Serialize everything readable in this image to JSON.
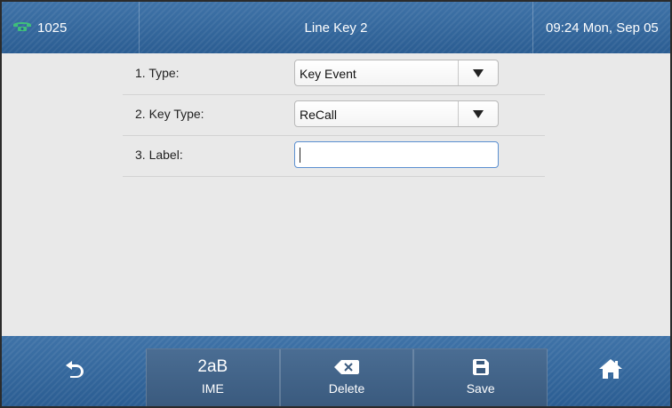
{
  "status_bar": {
    "account": "1025",
    "title": "Line Key 2",
    "clock": "09:24 Mon, Sep 05"
  },
  "form": {
    "rows": [
      {
        "label": "1. Type:",
        "value": "Key Event",
        "control": "dropdown"
      },
      {
        "label": "2. Key Type:",
        "value": "ReCall",
        "control": "dropdown"
      },
      {
        "label": "3. Label:",
        "value": "",
        "control": "text"
      }
    ]
  },
  "softkeys": {
    "ime": {
      "glyph": "2aB",
      "label": "IME"
    },
    "delete": {
      "label": "Delete",
      "icon": "backspace-icon"
    },
    "save": {
      "label": "Save",
      "icon": "save-icon"
    }
  },
  "nav": {
    "back_icon": "back-arrow-icon",
    "home_icon": "home-icon"
  },
  "colors": {
    "bar_blue": "#3a6aa0",
    "phone_icon_green": "#3fbf7a",
    "softkey_blue": "#4a6d93",
    "form_background": "#e9e9e9"
  }
}
